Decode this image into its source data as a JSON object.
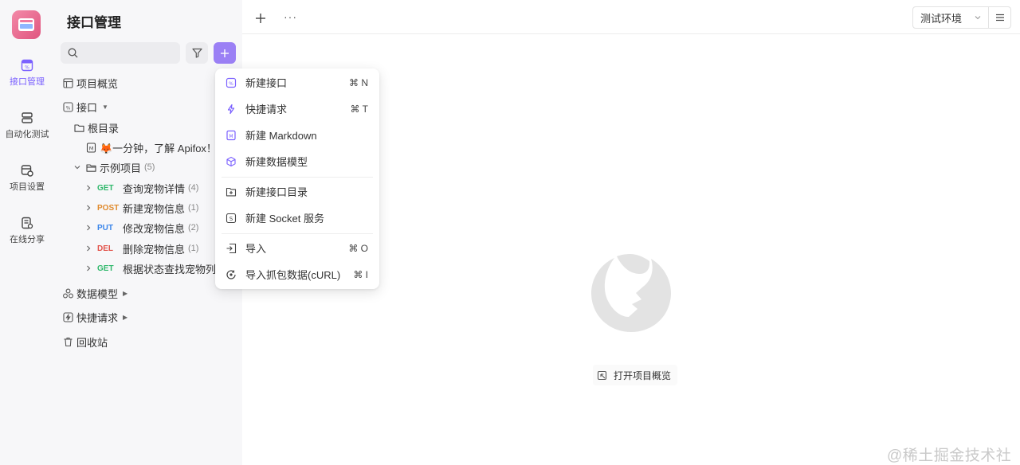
{
  "rail": {
    "items": [
      {
        "label": "接口管理",
        "icon": "api-icon"
      },
      {
        "label": "自动化测试",
        "icon": "automation-icon"
      },
      {
        "label": "项目设置",
        "icon": "settings-icon"
      },
      {
        "label": "在线分享",
        "icon": "share-icon"
      }
    ]
  },
  "sidebar": {
    "title": "接口管理",
    "overview": "项目概览",
    "interfaces": "接口",
    "root": "根目录",
    "doc": "🦊一分钟，了解 Apifox！",
    "folder": {
      "label": "示例项目",
      "count": "(5)"
    },
    "endpoints": [
      {
        "method": "GET",
        "label": "查询宠物详情",
        "count": "(4)"
      },
      {
        "method": "POST",
        "label": "新建宠物信息",
        "count": "(1)"
      },
      {
        "method": "PUT",
        "label": "修改宠物信息",
        "count": "(2)"
      },
      {
        "method": "DEL",
        "label": "删除宠物信息",
        "count": "(1)"
      },
      {
        "method": "GET",
        "label": "根据状态查找宠物列...",
        "count": ""
      }
    ],
    "models": "数据模型",
    "quick": "快捷请求",
    "trash": "回收站"
  },
  "topbar": {
    "more": "···",
    "env": "测试环境"
  },
  "dropdown": {
    "items": [
      {
        "label": "新建接口",
        "shortcut": "⌘ N"
      },
      {
        "label": "快捷请求",
        "shortcut": "⌘ T"
      },
      {
        "label": "新建 Markdown",
        "shortcut": ""
      },
      {
        "label": "新建数据模型",
        "shortcut": ""
      },
      {
        "label": "新建接口目录",
        "shortcut": ""
      },
      {
        "label": "新建 Socket 服务",
        "shortcut": ""
      },
      {
        "label": "导入",
        "shortcut": "⌘ O"
      },
      {
        "label": "导入抓包数据(cURL)",
        "shortcut": "⌘ I"
      }
    ]
  },
  "main": {
    "open_overview": "打开项目概览"
  },
  "watermark": "@稀土掘金技术社区",
  "colors": {
    "accent": "#7b61ff",
    "get": "#2fb86b",
    "post": "#e08a2c",
    "put": "#3a85ea",
    "del": "#e2524a"
  }
}
